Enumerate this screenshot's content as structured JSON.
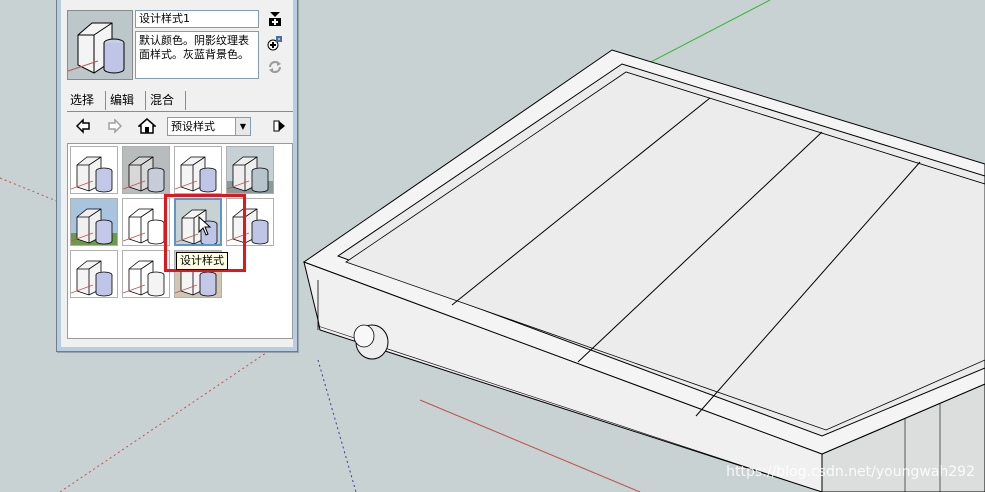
{
  "colors": {
    "viewport_bg": "#c9d2d2",
    "selection_highlight": "#e8141b",
    "selected_swatch_border": "#5c97c9",
    "green_axis": "#2db82d",
    "red_axis": "#c0504d",
    "blue_axis": "#3a3a9a"
  },
  "styles_panel": {
    "style_name": "设计样式1",
    "style_description": "默认颜色。阴影纹理表面样式。灰蓝背景色。",
    "side_icons": [
      "create-style-icon",
      "update-style-icon",
      "refresh-icon"
    ],
    "tabs": [
      {
        "label": "选择",
        "active": true
      },
      {
        "label": "编辑",
        "active": false
      },
      {
        "label": "混合",
        "active": false
      }
    ],
    "nav": {
      "back_icon": "back-arrow-icon",
      "forward_icon": "forward-arrow-icon",
      "home_icon": "home-icon",
      "collection": "预设样式",
      "details_icon": "details-icon"
    },
    "swatches": [
      {
        "name": "style-swatch-1",
        "variant": "sketch"
      },
      {
        "name": "style-swatch-2",
        "variant": "gray"
      },
      {
        "name": "style-swatch-3",
        "variant": "plain"
      },
      {
        "name": "style-swatch-4",
        "variant": "sky"
      },
      {
        "name": "style-swatch-5",
        "variant": "green"
      },
      {
        "name": "style-swatch-6",
        "variant": "outline"
      },
      {
        "name": "style-swatch-7",
        "variant": "design",
        "selected": true
      },
      {
        "name": "style-swatch-8",
        "variant": "plain"
      },
      {
        "name": "style-swatch-9",
        "variant": "plain"
      },
      {
        "name": "style-swatch-10",
        "variant": "white"
      },
      {
        "name": "style-swatch-11",
        "variant": "tan"
      }
    ],
    "tooltip": "设计样式"
  },
  "watermark": "https://blog.csdn.net/youngwah292"
}
